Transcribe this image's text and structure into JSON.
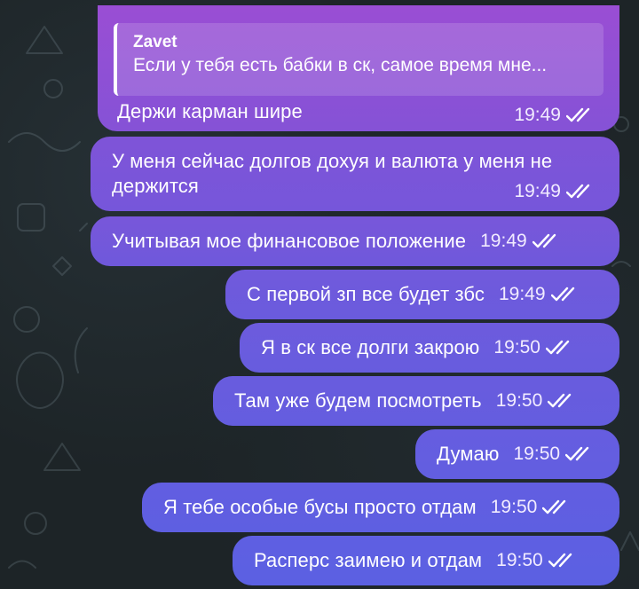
{
  "reply_message": {
    "quoted_author": "Zavet",
    "quoted_text": "Если у тебя есть бабки в ск, самое время мне...",
    "text": "Держи карман шире",
    "time": "19:49"
  },
  "messages": [
    {
      "text": "У меня сейчас долгов дохуя и валюта у меня не держится",
      "time": "19:49"
    },
    {
      "text": "Учитывая мое финансовое положение",
      "time": "19:49"
    },
    {
      "text": "С первой зп все будет збс",
      "time": "19:49"
    },
    {
      "text": "Я в ск все долги закрою",
      "time": "19:50"
    },
    {
      "text": "Там уже будем посмотреть",
      "time": "19:50"
    },
    {
      "text": "Думаю",
      "time": "19:50"
    },
    {
      "text": "Я тебе особые бусы просто отдам",
      "time": "19:50"
    },
    {
      "text": "Расперс заимею и отдам",
      "time": "19:50"
    }
  ],
  "colors": {
    "background": "#1d2427",
    "bubble_top": "#8a4fd0",
    "bubble_bottom": "#5b5fe0",
    "text": "#ffffff"
  },
  "icons": {
    "read_status": "double-check-icon",
    "background_pattern": "doodle-pattern"
  }
}
